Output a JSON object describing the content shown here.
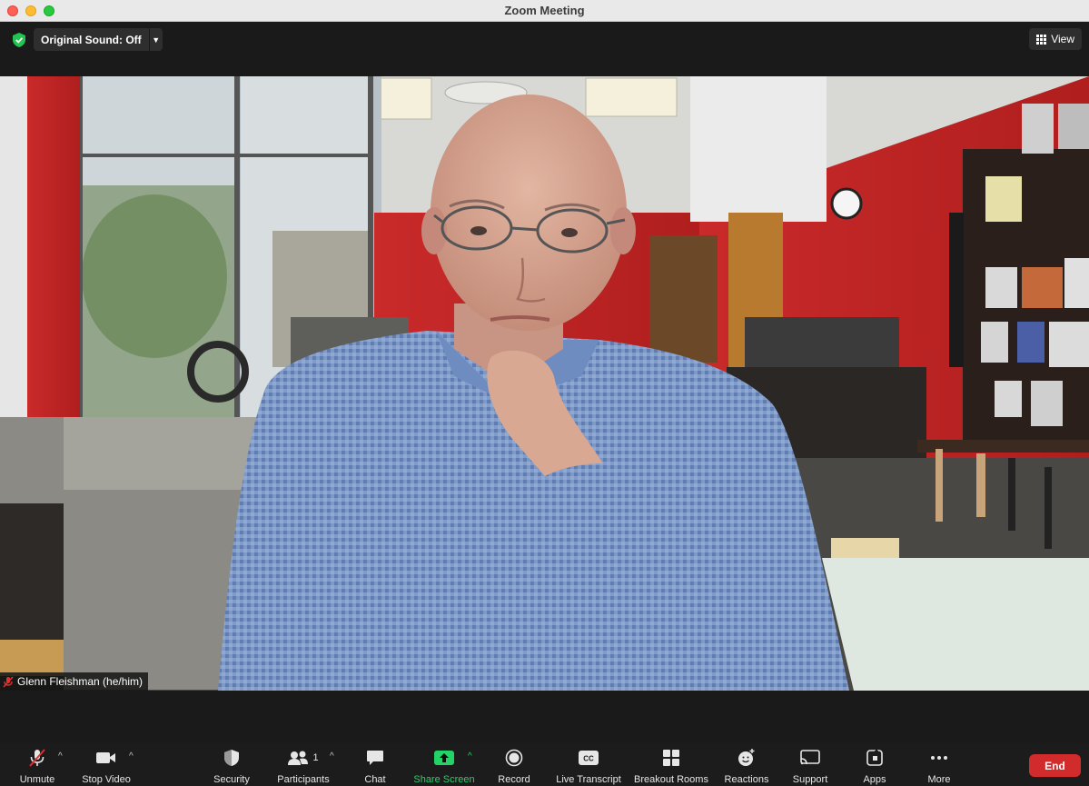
{
  "window": {
    "title": "Zoom Meeting"
  },
  "top_bar": {
    "original_sound_label": "Original Sound: Off",
    "view_label": "View"
  },
  "video": {
    "participant_name": "Glenn Fleishman  (he/him)"
  },
  "toolbar": {
    "unmute": "Unmute",
    "stop_video": "Stop Video",
    "security": "Security",
    "participants": "Participants",
    "participants_count": "1",
    "chat": "Chat",
    "share_screen": "Share Screen",
    "record": "Record",
    "live_transcript": "Live Transcript",
    "breakout_rooms": "Breakout Rooms",
    "reactions": "Reactions",
    "support": "Support",
    "apps": "Apps",
    "more": "More",
    "end": "End"
  },
  "colors": {
    "share_green": "#23d366",
    "end_red": "#d22b2b",
    "toolbar_bg": "#1c1c1c"
  }
}
